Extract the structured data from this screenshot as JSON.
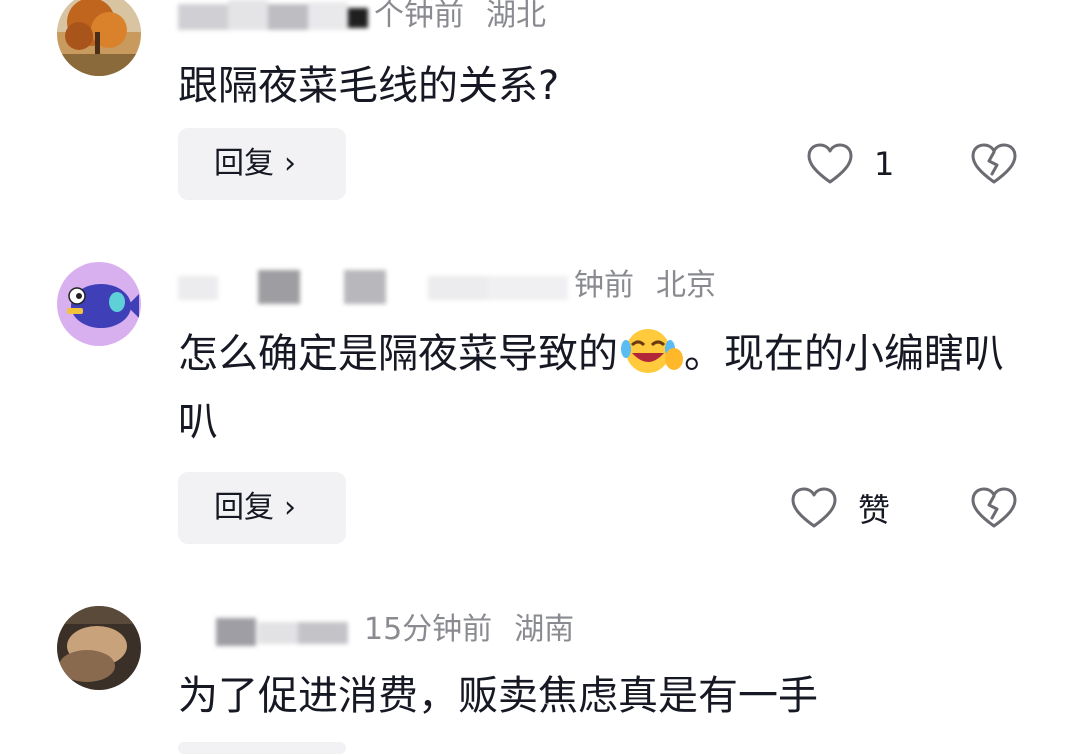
{
  "comments": [
    {
      "name_hidden": true,
      "time": "个钟前",
      "location": "湖北",
      "text": "跟隔夜菜毛线的关系?",
      "reply_label": "回复",
      "like_label": "1",
      "icons": {
        "like": "heart-outline-icon",
        "dislike": "broken-heart-icon",
        "reply_chevron": "chevron-right-icon"
      }
    },
    {
      "name_hidden": true,
      "time": "钟前",
      "location": "北京",
      "text_before_emoji": "怎么确定是隔夜菜导致的",
      "emoji": "laughing-crying-emoji",
      "text_after_emoji": "。现在的小编瞎叭叭",
      "reply_label": "回复",
      "like_label": "赞",
      "icons": {
        "like": "heart-outline-icon",
        "dislike": "broken-heart-icon",
        "reply_chevron": "chevron-right-icon"
      }
    },
    {
      "name_hidden": true,
      "time": "15分钟前",
      "location": "湖南",
      "text": "为了促进消费，贩卖焦虑真是有一手"
    }
  ],
  "colors": {
    "text_primary": "#161823",
    "text_secondary": "#8a8b91",
    "reply_bg": "#f2f2f4",
    "icon_stroke": "#6b6c72"
  }
}
